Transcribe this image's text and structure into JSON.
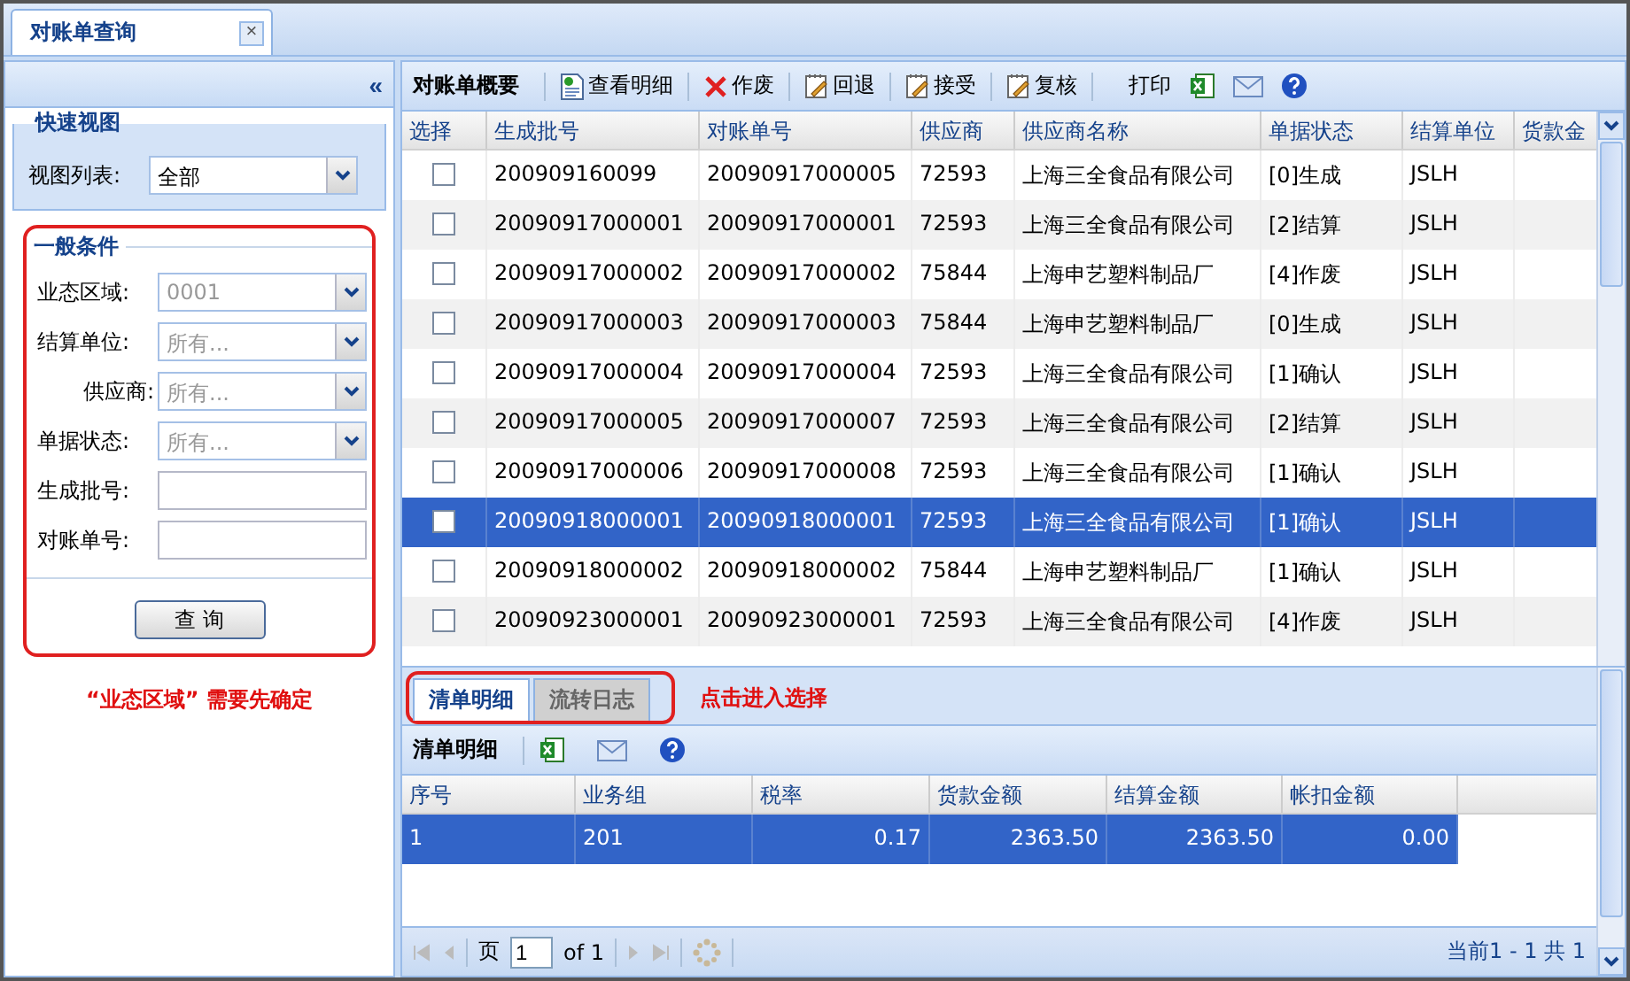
{
  "tab": {
    "title": "对账单查询",
    "close": "×"
  },
  "left": {
    "collapse": "«",
    "quick_view": {
      "legend": "快速视图",
      "label": "视图列表:",
      "value": "全部"
    },
    "conditions": {
      "legend": "一般条件",
      "fields": [
        {
          "label": "业态区域:",
          "kind": "select",
          "value": "0001"
        },
        {
          "label": "结算单位:",
          "kind": "select",
          "placeholder": "所有..."
        },
        {
          "label": "供应商:",
          "kind": "select",
          "placeholder": "所有..."
        },
        {
          "label": "单据状态:",
          "kind": "select",
          "placeholder": "所有..."
        },
        {
          "label": "生成批号:",
          "kind": "text"
        },
        {
          "label": "对账单号:",
          "kind": "text"
        }
      ]
    },
    "query_button": "查 询",
    "note": "“业态区域” 需要先确定"
  },
  "grid": {
    "title": "对账单概要",
    "toolbar": [
      {
        "kind": "doc",
        "label": "查看明细"
      },
      {
        "kind": "cross",
        "label": "作废"
      },
      {
        "kind": "edit",
        "label": "回退"
      },
      {
        "kind": "edit",
        "label": "接受"
      },
      {
        "kind": "edit",
        "label": "复核"
      },
      {
        "kind": "text",
        "label": "打印"
      },
      {
        "kind": "excel"
      },
      {
        "kind": "mail"
      },
      {
        "kind": "help"
      }
    ],
    "columns": [
      "选择",
      "生成批号",
      "对账单号",
      "供应商",
      "供应商名称",
      "单据状态",
      "结算单位",
      "货款金"
    ],
    "rows": [
      {
        "checked": false,
        "selected": false,
        "cells": [
          "",
          "200909160099",
          "20090917000005",
          "72593",
          "上海三全食品有限公司",
          "[0]生成",
          "JSLH"
        ]
      },
      {
        "checked": false,
        "selected": false,
        "cells": [
          "",
          "20090917000001",
          "20090917000001",
          "72593",
          "上海三全食品有限公司",
          "[2]结算",
          "JSLH"
        ]
      },
      {
        "checked": false,
        "selected": false,
        "cells": [
          "",
          "20090917000002",
          "20090917000002",
          "75844",
          "上海申艺塑料制品厂",
          "[4]作废",
          "JSLH"
        ]
      },
      {
        "checked": false,
        "selected": false,
        "cells": [
          "",
          "20090917000003",
          "20090917000003",
          "75844",
          "上海申艺塑料制品厂",
          "[0]生成",
          "JSLH"
        ]
      },
      {
        "checked": false,
        "selected": false,
        "cells": [
          "",
          "20090917000004",
          "20090917000004",
          "72593",
          "上海三全食品有限公司",
          "[1]确认",
          "JSLH"
        ]
      },
      {
        "checked": false,
        "selected": false,
        "cells": [
          "",
          "20090917000005",
          "20090917000007",
          "72593",
          "上海三全食品有限公司",
          "[2]结算",
          "JSLH"
        ]
      },
      {
        "checked": false,
        "selected": false,
        "cells": [
          "",
          "20090917000006",
          "20090917000008",
          "72593",
          "上海三全食品有限公司",
          "[1]确认",
          "JSLH"
        ]
      },
      {
        "checked": false,
        "selected": true,
        "cells": [
          "",
          "20090918000001",
          "20090918000001",
          "72593",
          "上海三全食品有限公司",
          "[1]确认",
          "JSLH"
        ]
      },
      {
        "checked": false,
        "selected": false,
        "cells": [
          "",
          "20090918000002",
          "20090918000002",
          "75844",
          "上海申艺塑料制品厂",
          "[1]确认",
          "JSLH"
        ]
      },
      {
        "checked": false,
        "selected": false,
        "cells": [
          "",
          "20090923000001",
          "20090923000001",
          "72593",
          "上海三全食品有限公司",
          "[4]作废",
          "JSLH"
        ]
      }
    ]
  },
  "detail": {
    "tabs": [
      {
        "label": "清单明细",
        "selected": true
      },
      {
        "label": "流转日志",
        "selected": false
      }
    ],
    "hint": "点击进入选择",
    "title": "清单明细",
    "toolbar": [
      {
        "kind": "excel"
      },
      {
        "kind": "mail"
      },
      {
        "kind": "help"
      }
    ],
    "columns": [
      "序号",
      "业务组",
      "税率",
      "货款金额",
      "结算金额",
      "帐扣金额"
    ],
    "rows": [
      {
        "selected": true,
        "cells": [
          "1",
          "201",
          "0.17",
          "2363.50",
          "2363.50",
          "0.00"
        ]
      }
    ],
    "pager": {
      "page_label": "页",
      "page": "1",
      "of": "of 1",
      "status": "当前1 - 1 共 1"
    }
  }
}
